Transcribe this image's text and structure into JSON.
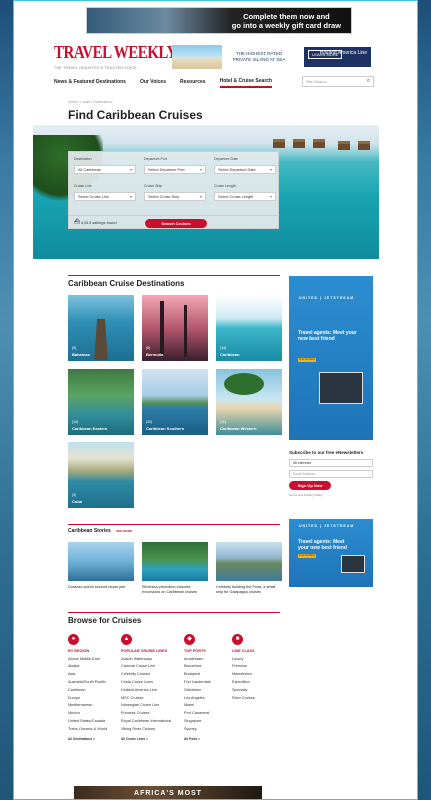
{
  "top_ad": {
    "line1": "Complete them now and",
    "line2": "go into a weekly gift card draw"
  },
  "header": {
    "logo": "TRAVEL WEEKLY",
    "tagline": "THE TRAVEL INDUSTRY'S TRUSTED VOICE",
    "promo_text": "THE HIGHEST RATED PRIVATE ISLAND AT SEA",
    "promo_button": "LEARN MORE",
    "promo_brand": "Holland America Line"
  },
  "nav": {
    "items": [
      "News & Featured Destinations",
      "Our Voices",
      "Resources",
      "Hotel & Cruise Search"
    ],
    "search_placeholder": "Site Search"
  },
  "breadcrumb": "Home / Cruise / Destinations",
  "page_title": "Find Caribbean Cruises",
  "search_form": {
    "labels": [
      "Destination",
      "Departure Port",
      "Departure Date",
      "Cruise Line",
      "Cruise Ship",
      "Cruise Length"
    ],
    "values": [
      "All Caribbean",
      "Select Departure Port",
      "Select Departure Date",
      "Select Cruise Line",
      "Select Cruise Ship",
      "Select Cruise Length"
    ],
    "count": "4,813 sailings found",
    "button": "Search Cruises"
  },
  "destinations": {
    "title": "Caribbean Cruise Destinations",
    "items": [
      {
        "name": "Bahamas",
        "count": "(9)"
      },
      {
        "name": "Bermuda",
        "count": "(8)"
      },
      {
        "name": "Caribbean",
        "count": "(14)"
      },
      {
        "name": "Caribbean Eastern",
        "count": "(10)"
      },
      {
        "name": "Caribbean Southern",
        "count": "(20)"
      },
      {
        "name": "Caribbean Western",
        "count": "(11)"
      },
      {
        "name": "Cuba",
        "count": "(3)"
      }
    ]
  },
  "ad1": {
    "brand": "UNITED | JETSTREAM",
    "text": "Travel agents: Meet your new best friend",
    "button": "Find Out More"
  },
  "newsletter": {
    "title": "Subscribe to our free eNewsletters",
    "select": "All interests",
    "email_placeholder": "Email Address",
    "button": "Sign Up Now",
    "terms": "Terms and Privacy Policy"
  },
  "ad2": {
    "brand": "UNITED | JETSTREAM",
    "text": "Travel agents: Meet your new best friend",
    "button": "Find Out More"
  },
  "stories": {
    "title": "Caribbean Stories",
    "see_more": "SEE MORE",
    "items": [
      {
        "caption": "Duracao opens second cruise pier"
      },
      {
        "caption": "Silversea promotion includes excursions on Caribbean cruises"
      },
      {
        "caption": "Celebrity building the Flora, a small ship for Galapagos cruises"
      }
    ]
  },
  "browse": {
    "title": "Browse for Cruises",
    "columns": [
      {
        "icon": "●",
        "heading": "BY REGION",
        "items": [
          "Africa/ Middle East",
          "Alaska",
          "Asia",
          "Australia/South Pacific",
          "Caribbean",
          "Europe",
          "Mediterranean",
          "Mexico",
          "United States/Canada",
          "Trans-Oceanic & World"
        ],
        "more": "All Destinations >"
      },
      {
        "icon": "▲",
        "heading": "POPULAR CRUISE LINES",
        "items": [
          "Avalon Waterways",
          "Carnival Cruise Line",
          "Celebrity Cruises",
          "Costa Cruise Lines",
          "Holland America Line",
          "MSC Cruises",
          "Norwegian Cruise Line",
          "Princess Cruises",
          "Royal Caribbean International",
          "Viking River Cruises"
        ],
        "more": "All Cruise Lines >"
      },
      {
        "icon": "◆",
        "heading": "TOP PORTS",
        "items": [
          "Amsterdam",
          "Barcelona",
          "Budapest",
          "Fort Lauderdale",
          "Galveston",
          "Los Angeles",
          "Miami",
          "Port Canaveral",
          "Singapore",
          "Sydney"
        ],
        "more": "All Ports >"
      },
      {
        "icon": "■",
        "heading": "LINE CLASS",
        "items": [
          "Luxury",
          "Premium",
          "Mainstream",
          "Expedition",
          "Specialty",
          "River Cruises"
        ],
        "more": ""
      }
    ]
  },
  "bottom_ad": "AFRICA'S MOST"
}
